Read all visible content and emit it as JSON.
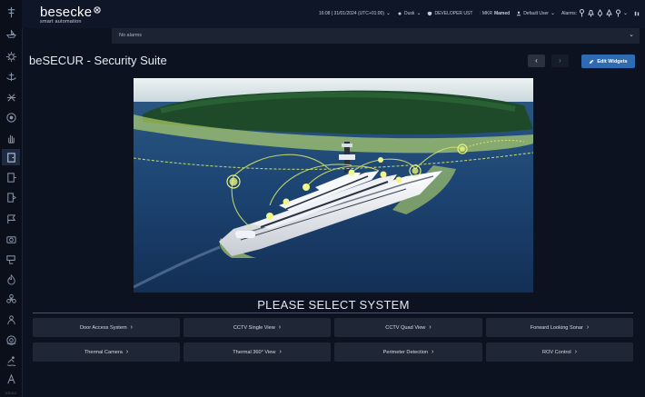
{
  "brand": {
    "name": "besecke",
    "tagline": "smart automation"
  },
  "topbar": {
    "datetime": "16:08 | 31/01/2024 (UTC+01:00)",
    "mode": "Dusk",
    "profile": "DEVELOPER UST",
    "location_code": "MKR",
    "location_name": "Mamed",
    "user": "Default User",
    "alarms_label": "Alarms:"
  },
  "alarm_strip": {
    "text": "No alarms"
  },
  "page": {
    "title": "beSECUR - Security Suite",
    "prev_label": "‹",
    "next_label": "›",
    "edit_label": "Edit Widgets"
  },
  "systems": {
    "heading": "PLEASE SELECT SYSTEM",
    "buttons": [
      "Door Access System",
      "CCTV Single View",
      "CCTV Quad View",
      "Forward Looking Sonar",
      "Thermal Camera",
      "Thermal 360° View",
      "Perimeter Detection",
      "ROV Control"
    ]
  },
  "rail": {
    "footer": "V.0.0.1"
  },
  "colors": {
    "accent": "#2e6bb3",
    "background": "#0c1220",
    "button": "#1f2635",
    "perimeter_zone": "#c8e86a"
  },
  "icons": {
    "rail": [
      "mast-icon",
      "boat-icon",
      "gear-icon",
      "anchor-icon",
      "eye-icon",
      "hand-icon",
      "door-icon",
      "door-open-icon",
      "flag-icon",
      "camera-icon",
      "cctv-icon",
      "fire-icon",
      "fan-icon",
      "diver-icon",
      "lifebuoy-icon",
      "swimmer-icon",
      "text-icon"
    ]
  }
}
